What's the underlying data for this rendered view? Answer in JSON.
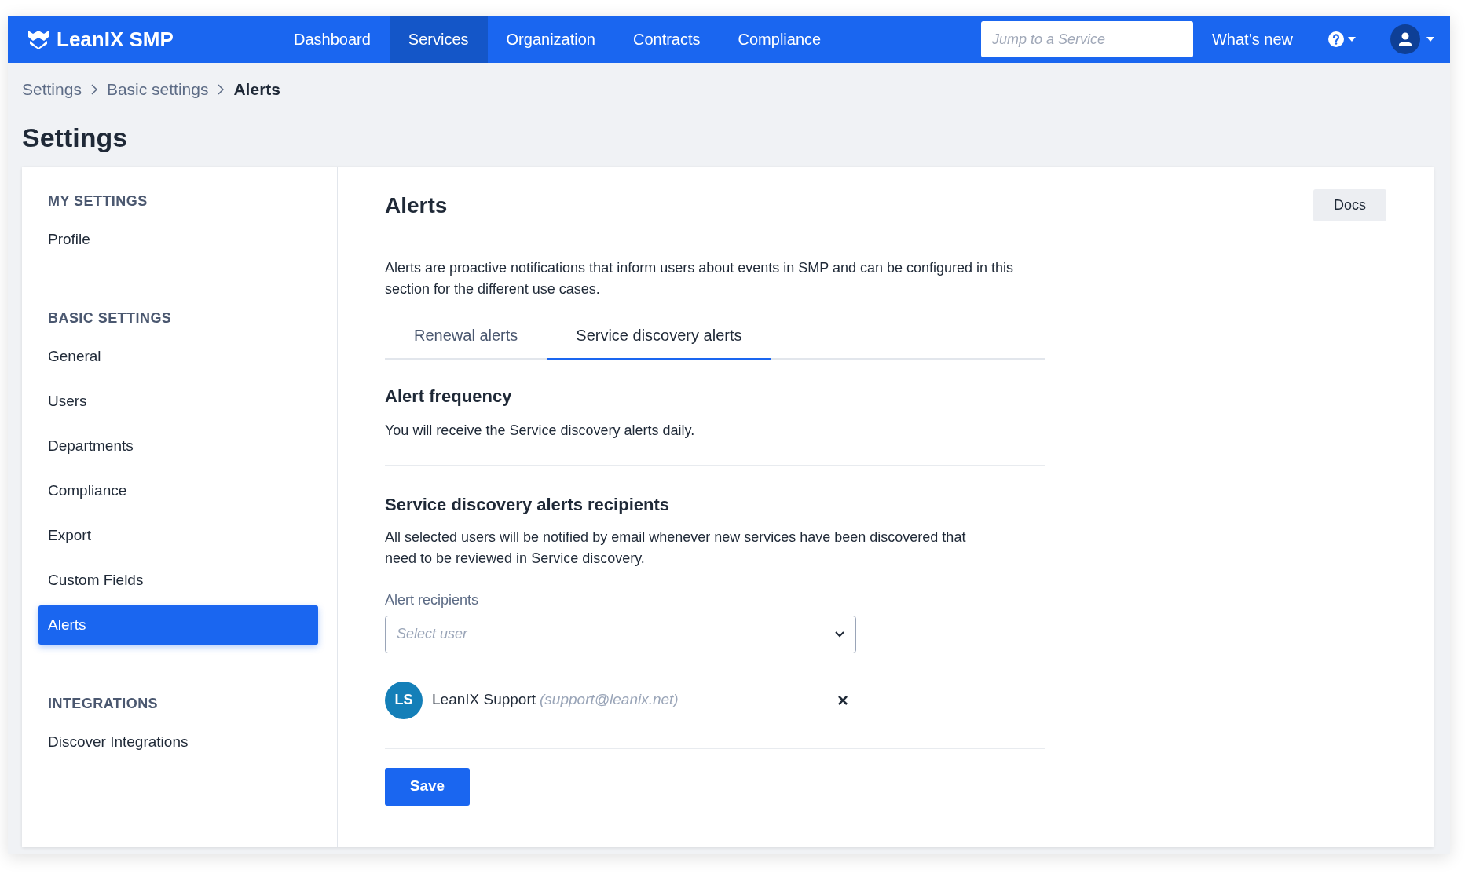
{
  "navbar": {
    "brand": "LeanIX SMP",
    "items": [
      {
        "label": "Dashboard",
        "selected": false
      },
      {
        "label": "Services",
        "selected": true
      },
      {
        "label": "Organization",
        "selected": false
      },
      {
        "label": "Contracts",
        "selected": false
      },
      {
        "label": "Compliance",
        "selected": false
      }
    ],
    "search": {
      "placeholder": "Jump to a Service"
    },
    "whats_new": "What’s new"
  },
  "breadcrumb": [
    "Settings",
    "Basic settings",
    "Alerts"
  ],
  "page_title": "Settings",
  "sidebar": {
    "sections": [
      {
        "heading": "MY SETTINGS",
        "items": [
          {
            "label": "Profile",
            "selected": false
          }
        ]
      },
      {
        "heading": "BASIC SETTINGS",
        "items": [
          {
            "label": "General",
            "selected": false
          },
          {
            "label": "Users",
            "selected": false
          },
          {
            "label": "Departments",
            "selected": false
          },
          {
            "label": "Compliance",
            "selected": false
          },
          {
            "label": "Export",
            "selected": false
          },
          {
            "label": "Custom Fields",
            "selected": false
          },
          {
            "label": "Alerts",
            "selected": true
          }
        ]
      },
      {
        "heading": "INTEGRATIONS",
        "items": [
          {
            "label": "Discover Integrations",
            "selected": false
          }
        ]
      }
    ]
  },
  "content": {
    "title": "Alerts",
    "docs_button": "Docs",
    "intro": "Alerts are proactive notifications that inform users about events in SMP and can be configured in this section for the different use cases.",
    "tabs": [
      {
        "label": "Renewal alerts",
        "selected": false
      },
      {
        "label": "Service discovery alerts",
        "selected": true
      }
    ],
    "frequency": {
      "heading": "Alert frequency",
      "text": "You will receive the Service discovery alerts daily."
    },
    "recipients": {
      "heading": "Service discovery alerts recipients",
      "text": "All selected users will be notified by email whenever new services have been discovered that need to be reviewed in Service discovery.",
      "field_label": "Alert recipients",
      "placeholder": "Select user",
      "users": [
        {
          "initials": "LS",
          "name": "LeanIX Support",
          "email": "(support@leanix.net)",
          "remove": "×"
        }
      ]
    },
    "save_button": "Save"
  }
}
